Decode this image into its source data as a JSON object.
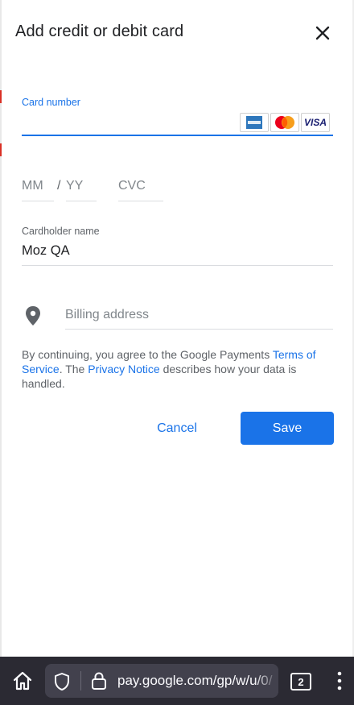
{
  "dialog": {
    "title": "Add credit or debit card"
  },
  "card_number": {
    "label": "Card number",
    "value": "",
    "logos": [
      "amex-logo",
      "mastercard-logo",
      "visa-logo"
    ],
    "visa_text": "VISA"
  },
  "expiry": {
    "month_placeholder": "MM",
    "separator": "/",
    "year_placeholder": "YY"
  },
  "cvc": {
    "placeholder": "CVC"
  },
  "cardholder": {
    "label": "Cardholder name",
    "value": "Moz QA"
  },
  "billing": {
    "icon": "location-pin-icon",
    "placeholder": "Billing address"
  },
  "terms": {
    "prefix": "By continuing, you agree to the Google Payments ",
    "tos_link": "Terms of Service",
    "middle": ". The ",
    "privacy_link": "Privacy Notice",
    "suffix": " describes how your data is handled."
  },
  "actions": {
    "cancel_label": "Cancel",
    "save_label": "Save"
  },
  "browser_toolbar": {
    "url": "pay.google.com/gp/w/u/0/",
    "tab_count": "2"
  },
  "colors": {
    "accent": "#1a73e8",
    "toolbar_bg": "#2b2a33",
    "url_bg": "#42414d"
  }
}
